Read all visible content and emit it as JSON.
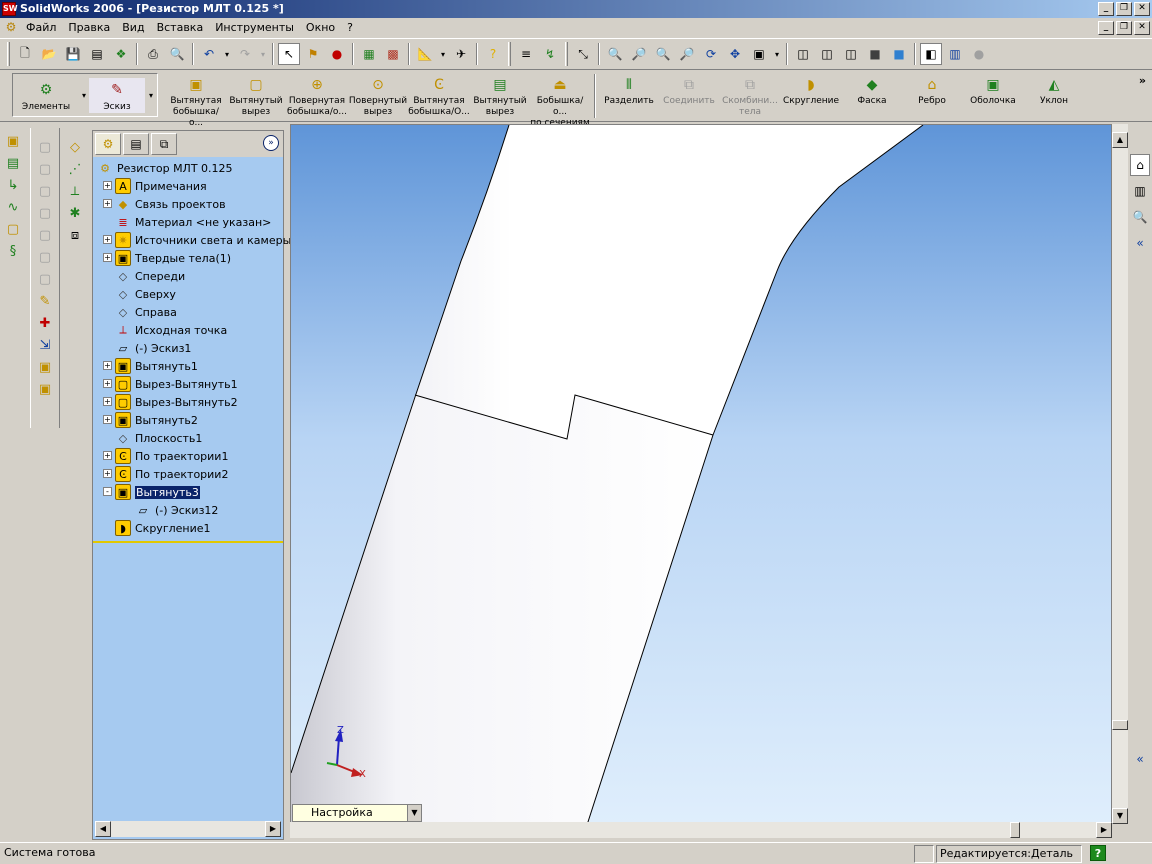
{
  "window": {
    "title": "SolidWorks 2006 - [Резистор МЛТ 0.125 *]",
    "app_icon": "SW"
  },
  "menu": {
    "items": [
      "Файл",
      "Правка",
      "Вид",
      "Вставка",
      "Инструменты",
      "Окно",
      "?"
    ]
  },
  "command_manager": {
    "tabs": [
      {
        "label": "Элементы",
        "icon": "features-icon"
      },
      {
        "label": "Эскиз",
        "icon": "sketch-icon"
      }
    ],
    "buttons": [
      {
        "label": "Вытянутая\nбобышка/о...",
        "icon": "extruded-boss-icon",
        "enabled": true
      },
      {
        "label": "Вытянутый\nвырез",
        "icon": "extruded-cut-icon",
        "enabled": true
      },
      {
        "label": "Повернутая\nбобышка/о...",
        "icon": "revolved-boss-icon",
        "enabled": true
      },
      {
        "label": "Повернутый\nвырез",
        "icon": "revolved-cut-icon",
        "enabled": true
      },
      {
        "label": "Вытянутая\nбобышка/О...",
        "icon": "swept-boss-icon",
        "enabled": true
      },
      {
        "label": "Вытянутый\nвырез",
        "icon": "swept-cut-icon",
        "enabled": true
      },
      {
        "label": "Бобышка/о...\nпо сечениям",
        "icon": "loft-icon",
        "enabled": true
      },
      {
        "label": "Разделить",
        "icon": "split-icon",
        "enabled": true
      },
      {
        "label": "Соединить",
        "icon": "join-icon",
        "enabled": false
      },
      {
        "label": "Скомбини...\nтела",
        "icon": "combine-icon",
        "enabled": false
      },
      {
        "label": "Скругление",
        "icon": "fillet-icon",
        "enabled": true
      },
      {
        "label": "Фаска",
        "icon": "chamfer-icon",
        "enabled": true
      },
      {
        "label": "Ребро",
        "icon": "rib-icon",
        "enabled": true
      },
      {
        "label": "Оболочка",
        "icon": "shell-icon",
        "enabled": true
      },
      {
        "label": "Уклон",
        "icon": "draft-icon",
        "enabled": true
      }
    ],
    "more": "»"
  },
  "feature_manager": {
    "tabs": [
      "feature-tree-icon",
      "property-manager-icon",
      "configuration-manager-icon"
    ],
    "expand": "»",
    "tree": [
      {
        "label": "Резистор МЛТ 0.125",
        "icon": "part-icon",
        "level": 0,
        "expander": ""
      },
      {
        "label": "Примечания",
        "icon": "annotations-icon",
        "level": 1,
        "expander": "+"
      },
      {
        "label": "Связь проектов",
        "icon": "design-binder-icon",
        "level": 1,
        "expander": "+"
      },
      {
        "label": "Материал <не указан>",
        "icon": "material-icon",
        "level": 1,
        "expander": ""
      },
      {
        "label": "Источники света и камеры",
        "icon": "lights-icon",
        "level": 1,
        "expander": "+"
      },
      {
        "label": "Твердые тела(1)",
        "icon": "solid-bodies-icon",
        "level": 1,
        "expander": "+"
      },
      {
        "label": "Спереди",
        "icon": "plane-icon",
        "level": 1,
        "expander": ""
      },
      {
        "label": "Сверху",
        "icon": "plane-icon",
        "level": 1,
        "expander": ""
      },
      {
        "label": "Справа",
        "icon": "plane-icon",
        "level": 1,
        "expander": ""
      },
      {
        "label": "Исходная точка",
        "icon": "origin-icon",
        "level": 1,
        "expander": ""
      },
      {
        "label": "(-) Эскиз1",
        "icon": "sketch-icon",
        "level": 1,
        "expander": ""
      },
      {
        "label": "Вытянуть1",
        "icon": "extrude-icon",
        "level": 1,
        "expander": "+"
      },
      {
        "label": "Вырез-Вытянуть1",
        "icon": "cut-extrude-icon",
        "level": 1,
        "expander": "+"
      },
      {
        "label": "Вырез-Вытянуть2",
        "icon": "cut-extrude-icon",
        "level": 1,
        "expander": "+"
      },
      {
        "label": "Вытянуть2",
        "icon": "extrude-icon",
        "level": 1,
        "expander": "+"
      },
      {
        "label": "Плоскость1",
        "icon": "plane-icon",
        "level": 1,
        "expander": ""
      },
      {
        "label": "По траектории1",
        "icon": "sweep-icon",
        "level": 1,
        "expander": "+"
      },
      {
        "label": "По траектории2",
        "icon": "sweep-icon",
        "level": 1,
        "expander": "+"
      },
      {
        "label": "Вытянуть3",
        "icon": "extrude-icon",
        "level": 1,
        "expander": "-",
        "selected": true
      },
      {
        "label": "(-) Эскиз12",
        "icon": "sketch-icon",
        "level": 2,
        "expander": ""
      },
      {
        "label": "Скругление1",
        "icon": "fillet-icon",
        "level": 1,
        "expander": ""
      }
    ]
  },
  "viewport": {
    "triad": {
      "z": "Z",
      "x": "X"
    },
    "config_combo": "Настройка"
  },
  "statusbar": {
    "message": "Система готова",
    "mode": "Редактируется:Деталь",
    "help": "?"
  }
}
